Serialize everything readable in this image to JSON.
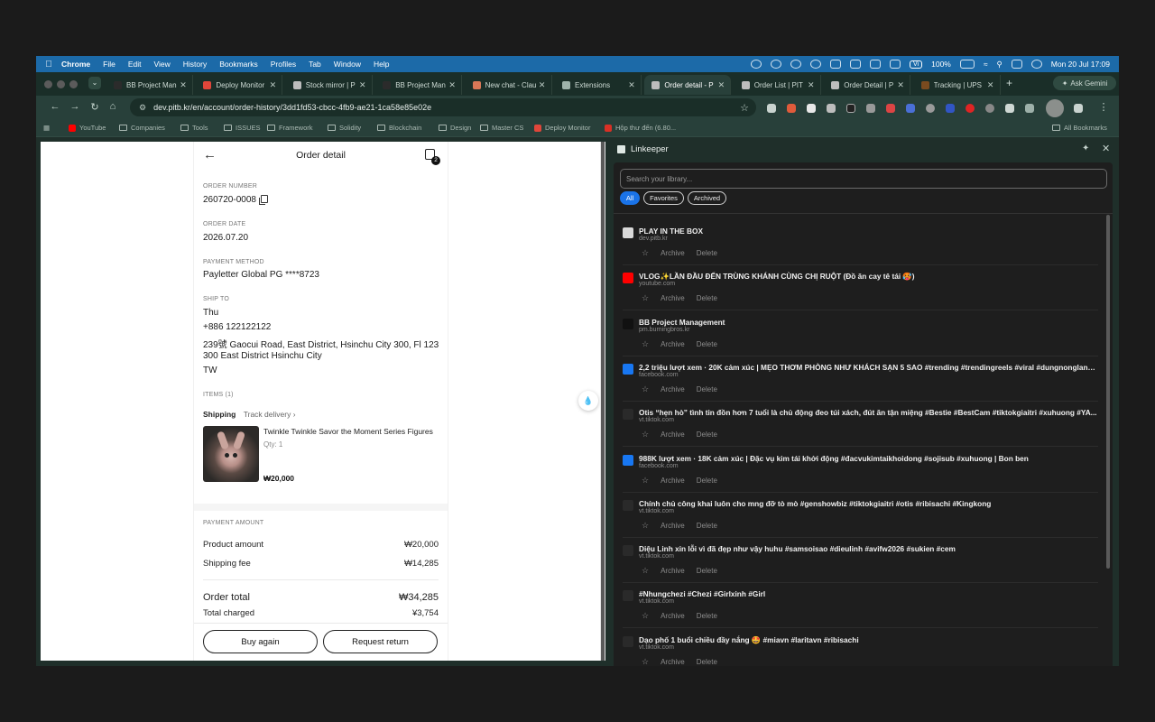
{
  "menubar": {
    "app": "Chrome",
    "items": [
      "File",
      "Edit",
      "View",
      "History",
      "Bookmarks",
      "Profiles",
      "Tab",
      "Window",
      "Help"
    ],
    "battery": "100%",
    "input_method": "Vi",
    "datetime": "Mon 20 Jul  17:09"
  },
  "tabs": [
    {
      "title": "BB Project Man",
      "active": false,
      "color": "#2b2b2b"
    },
    {
      "title": "Deploy Monitor",
      "active": false,
      "color": "#e0463a"
    },
    {
      "title": "Stock mirror | P",
      "active": false,
      "color": "#bdbdbd"
    },
    {
      "title": "BB Project Man",
      "active": false,
      "color": "#2b2b2b"
    },
    {
      "title": "New chat - Clau",
      "active": false,
      "color": "#d97757"
    },
    {
      "title": "Extensions",
      "active": false,
      "color": "#9fb3ab"
    },
    {
      "title": "Order detail - P",
      "active": true,
      "color": "#bdbdbd"
    },
    {
      "title": "Order List | PIT",
      "active": false,
      "color": "#bdbdbd"
    },
    {
      "title": "Order Detail | P",
      "active": false,
      "color": "#bdbdbd"
    },
    {
      "title": "Tracking | UPS",
      "active": false,
      "color": "#7a4b1f"
    }
  ],
  "ask_gemini": "Ask Gemini",
  "url": "dev.pitb.kr/en/account/order-history/3dd1fd53-cbcc-4fb9-ae21-1ca58e85e02e",
  "bookmarks": [
    {
      "label": "YouTube",
      "type": "site"
    },
    {
      "label": "Companies",
      "type": "folder"
    },
    {
      "label": "Tools",
      "type": "folder"
    },
    {
      "label": "ISSUES",
      "type": "folder"
    },
    {
      "label": "Framework",
      "type": "folder"
    },
    {
      "label": "Solidity",
      "type": "folder"
    },
    {
      "label": "Blockchain",
      "type": "folder"
    },
    {
      "label": "Design",
      "type": "folder"
    },
    {
      "label": "Master CS",
      "type": "folder"
    },
    {
      "label": "Deploy Monitor",
      "type": "site"
    },
    {
      "label": "Hộp thư đến (6.80...",
      "type": "site"
    }
  ],
  "all_bookmarks": "All Bookmarks",
  "order": {
    "title": "Order detail",
    "cart_count": "2",
    "order_number_label": "ORDER NUMBER",
    "order_number": "260720-0008",
    "order_date_label": "ORDER DATE",
    "order_date": "2026.07.20",
    "payment_method_label": "PAYMENT METHOD",
    "payment_method": "Payletter Global PG ****8723",
    "ship_to_label": "SHIP TO",
    "ship_name": "Thu",
    "ship_phone": "+886 122122122",
    "ship_address1": "239號 Gaocui Road, East District, Hsinchu City 300, Fl 123",
    "ship_address2": "300 East District Hsinchu City",
    "ship_country": "TW",
    "items_label": "ITEMS (1)",
    "shipping_label": "Shipping",
    "track_label": "Track delivery",
    "item_name": "Twinkle Twinkle Savor the Moment Series Figures",
    "item_qty": "Qty: 1",
    "item_price": "₩20,000",
    "payment_amount_label": "PAYMENT AMOUNT",
    "product_amount_label": "Product amount",
    "product_amount": "₩20,000",
    "shipping_fee_label": "Shipping fee",
    "shipping_fee": "₩14,285",
    "order_total_label": "Order total",
    "order_total": "₩34,285",
    "total_charged_label": "Total charged",
    "total_charged": "¥3,754",
    "buy_again": "Buy again",
    "request_return": "Request return"
  },
  "panel": {
    "title": "Linkeeper",
    "search_placeholder": "Search your library...",
    "filters": [
      "All",
      "Favorites",
      "Archived"
    ],
    "action_archive": "Archive",
    "action_delete": "Delete",
    "items": [
      {
        "title": "PLAY IN THE BOX",
        "domain": "dev.pitb.kr",
        "icon_color": "#d9d9d9"
      },
      {
        "title": "VLOG✨LẦN ĐẦU ĐẾN TRÙNG KHÁNH CÙNG CHỊ RUỘT (Đồ ăn cay tê tái 🥵)",
        "domain": "youtube.com",
        "icon_color": "#ff0000"
      },
      {
        "title": "BB Project Management",
        "domain": "pm.burningbros.kr",
        "icon_color": "#111111"
      },
      {
        "title": "2,2 triệu lượt xem · 20K cảm xúc | MẸO THƠM PHÒNG NHƯ KHÁCH SẠN 5 SAO #trending #trendingreels #viral #dungnonglanh...",
        "domain": "facebook.com",
        "icon_color": "#1877f2"
      },
      {
        "title": "Otis “hẹn hò” tình tin đồn hơn 7 tuổi là chủ động đeo túi xách, đút ăn tận miệng #Bestie #BestCam #tiktokgiaitri #xuhuong #YA...",
        "domain": "vt.tiktok.com",
        "icon_color": "#2a2a2a"
      },
      {
        "title": "988K lượt xem · 18K cảm xúc | Đặc vụ kim tái khởi động #đacvukimtaikhoidong #sojisub #xuhuong | Bon ben",
        "domain": "facebook.com",
        "icon_color": "#1877f2"
      },
      {
        "title": "Chính chủ công khai luôn cho mng đỡ tò mò #genshowbiz #tiktokgiaitri #otis #ribisachi #Kingkong",
        "domain": "vt.tiktok.com",
        "icon_color": "#2a2a2a"
      },
      {
        "title": "Diệu Linh xin lỗi vì đã đẹp như vậy huhu #samsoisao #dieulinh #avifw2026 #sukien #cem",
        "domain": "vt.tiktok.com",
        "icon_color": "#2a2a2a"
      },
      {
        "title": "#Nhungchezi #Chezi #Girlxinh #Girl",
        "domain": "vt.tiktok.com",
        "icon_color": "#2a2a2a"
      },
      {
        "title": "Dạo phố 1 buổi chiều đầy nắng 🤩 #miavn #laritavn #ribisachi",
        "domain": "vt.tiktok.com",
        "icon_color": "#2a2a2a"
      }
    ]
  }
}
